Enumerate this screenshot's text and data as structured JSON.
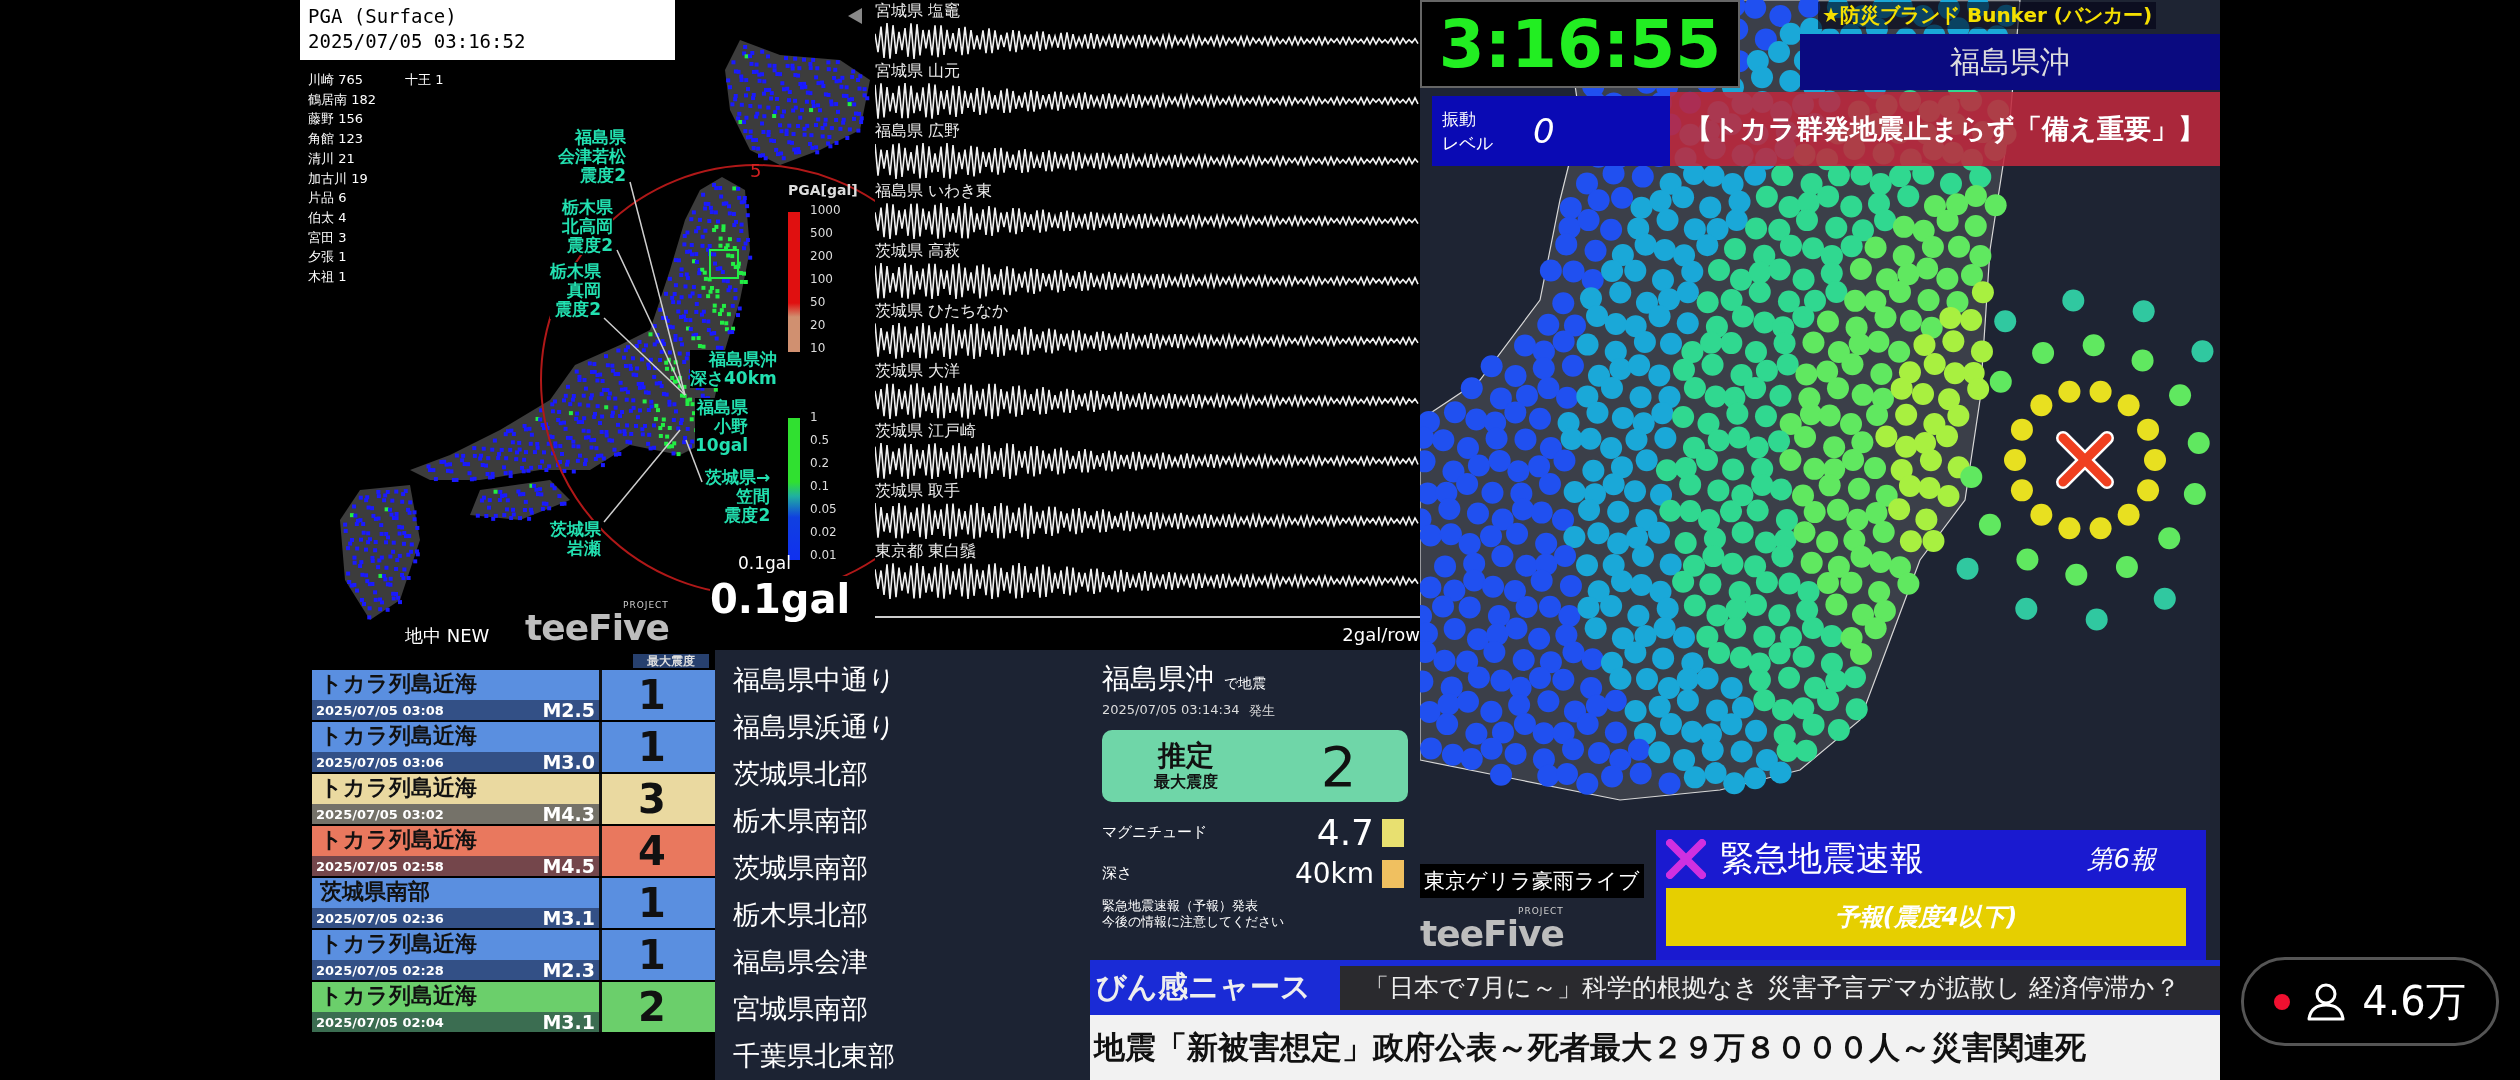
{
  "pga_panel": {
    "title": "PGA (Surface)",
    "timestamp": "2025/07/05 03:16:52",
    "stations": [
      "川崎 765",
      "鶴居南 182",
      "藤野 156",
      "角館 123",
      "清川 21",
      "加古川 19",
      "片品 6",
      "伯太 4",
      "宮田 3",
      "夕張 1",
      "木祖 1"
    ],
    "extra_station": "十王 1",
    "range_label": "5",
    "callouts": [
      {
        "lines": [
          "福島県",
          "会津若松",
          "震度2"
        ]
      },
      {
        "lines": [
          "栃木県",
          "北高岡",
          "震度2"
        ]
      },
      {
        "lines": [
          "栃木県",
          "真岡",
          "震度2"
        ]
      },
      {
        "lines": [
          "福島県沖",
          "深さ40km"
        ]
      },
      {
        "lines": [
          "福島県",
          "小野",
          "10gal"
        ]
      },
      {
        "lines": [
          "茨城県→",
          "笠間",
          "震度2"
        ]
      },
      {
        "lines": [
          "茨城県",
          "岩瀬"
        ]
      }
    ],
    "scale": {
      "title": "PGA[gal]",
      "upper_ticks": [
        "1000",
        "500",
        "200",
        "100",
        "50",
        "20",
        "10"
      ],
      "lower_ticks": [
        "1",
        "0.5",
        "0.2",
        "0.1",
        "0.05",
        "0.02",
        "0.01"
      ]
    },
    "threshold_small": "0.1gal",
    "threshold_large": "0.1gal",
    "mode_label": "地中 NEW",
    "logo": {
      "name": "teeFive",
      "tag": "PROJECT"
    }
  },
  "waveforms": {
    "stations": [
      "宮城県 塩竈",
      "宮城県 山元",
      "福島県 広野",
      "福島県 いわき東",
      "茨城県 高萩",
      "茨城県 ひたちなか",
      "茨城県 大洋",
      "茨城県 江戸崎",
      "茨城県 取手",
      "東京都 東白鬚"
    ],
    "scale_label": "2gal/row"
  },
  "quake_list": {
    "header": "最大震度",
    "rows": [
      {
        "region": "トカラ列島近海",
        "time": "2025/07/05 03:08",
        "magnitude": "M2.5",
        "intensity": "1",
        "color": "#5a8fe0"
      },
      {
        "region": "トカラ列島近海",
        "time": "2025/07/05 03:06",
        "magnitude": "M3.0",
        "intensity": "1",
        "color": "#5a8fe0"
      },
      {
        "region": "トカラ列島近海",
        "time": "2025/07/05 03:02",
        "magnitude": "M4.3",
        "intensity": "3",
        "color": "#ead9a0"
      },
      {
        "region": "トカラ列島近海",
        "time": "2025/07/05 02:58",
        "magnitude": "M4.5",
        "intensity": "4",
        "color": "#e9785e"
      },
      {
        "region": "茨城県南部",
        "time": "2025/07/05 02:36",
        "magnitude": "M3.1",
        "intensity": "1",
        "color": "#5a8fe0"
      },
      {
        "region": "トカラ列島近海",
        "time": "2025/07/05 02:28",
        "magnitude": "M2.3",
        "intensity": "1",
        "color": "#5a8fe0"
      },
      {
        "region": "トカラ列島近海",
        "time": "2025/07/05 02:04",
        "magnitude": "M3.1",
        "intensity": "2",
        "color": "#6bcf6b"
      }
    ]
  },
  "affected_regions": [
    "福島県中通り",
    "福島県浜通り",
    "茨城県北部",
    "栃木県南部",
    "茨城県南部",
    "栃木県北部",
    "福島県会津",
    "宮城県南部",
    "千葉県北東部"
  ],
  "eq_info": {
    "region": "福島県沖",
    "region_suffix": "で地震",
    "occurred": "2025/07/05 03:14:34",
    "occurred_suffix": "発生",
    "intensity_label": "推定",
    "intensity_sublabel": "最大震度",
    "intensity": "2",
    "magnitude_label": "マグニチュード",
    "magnitude": "4.7",
    "depth_label": "深さ",
    "depth": "40km",
    "notes": [
      "緊急地震速報（予報）発表",
      "今後の情報に注意してください"
    ]
  },
  "live_map": {
    "clock": "3:16:55",
    "sponsor": "★防災ブランド Bunker (バンカー)",
    "area_banner": "福島県沖",
    "shake_level_label": [
      "振動",
      "レベル"
    ],
    "shake_level": "0",
    "headline": "【トカラ群発地震止まらず「備え重要」】",
    "live_label": "東京ゲリラ豪雨ライブ",
    "logo": {
      "name": "teeFive",
      "tag": "PROJECT"
    },
    "eew": {
      "title": "緊急地震速報",
      "report": "第6報",
      "type": "予報(震度4以下)"
    }
  },
  "news": {
    "brand": "びん感ニャース",
    "headline": "「日本で7月に～」科学的根拠なき 災害予言デマが拡散し 経済停滞か？",
    "ticker": "地震「新被害想定」政府公表～死者最大２９万８０００人～災害関連死"
  },
  "viewers": {
    "count": "4.6万"
  }
}
